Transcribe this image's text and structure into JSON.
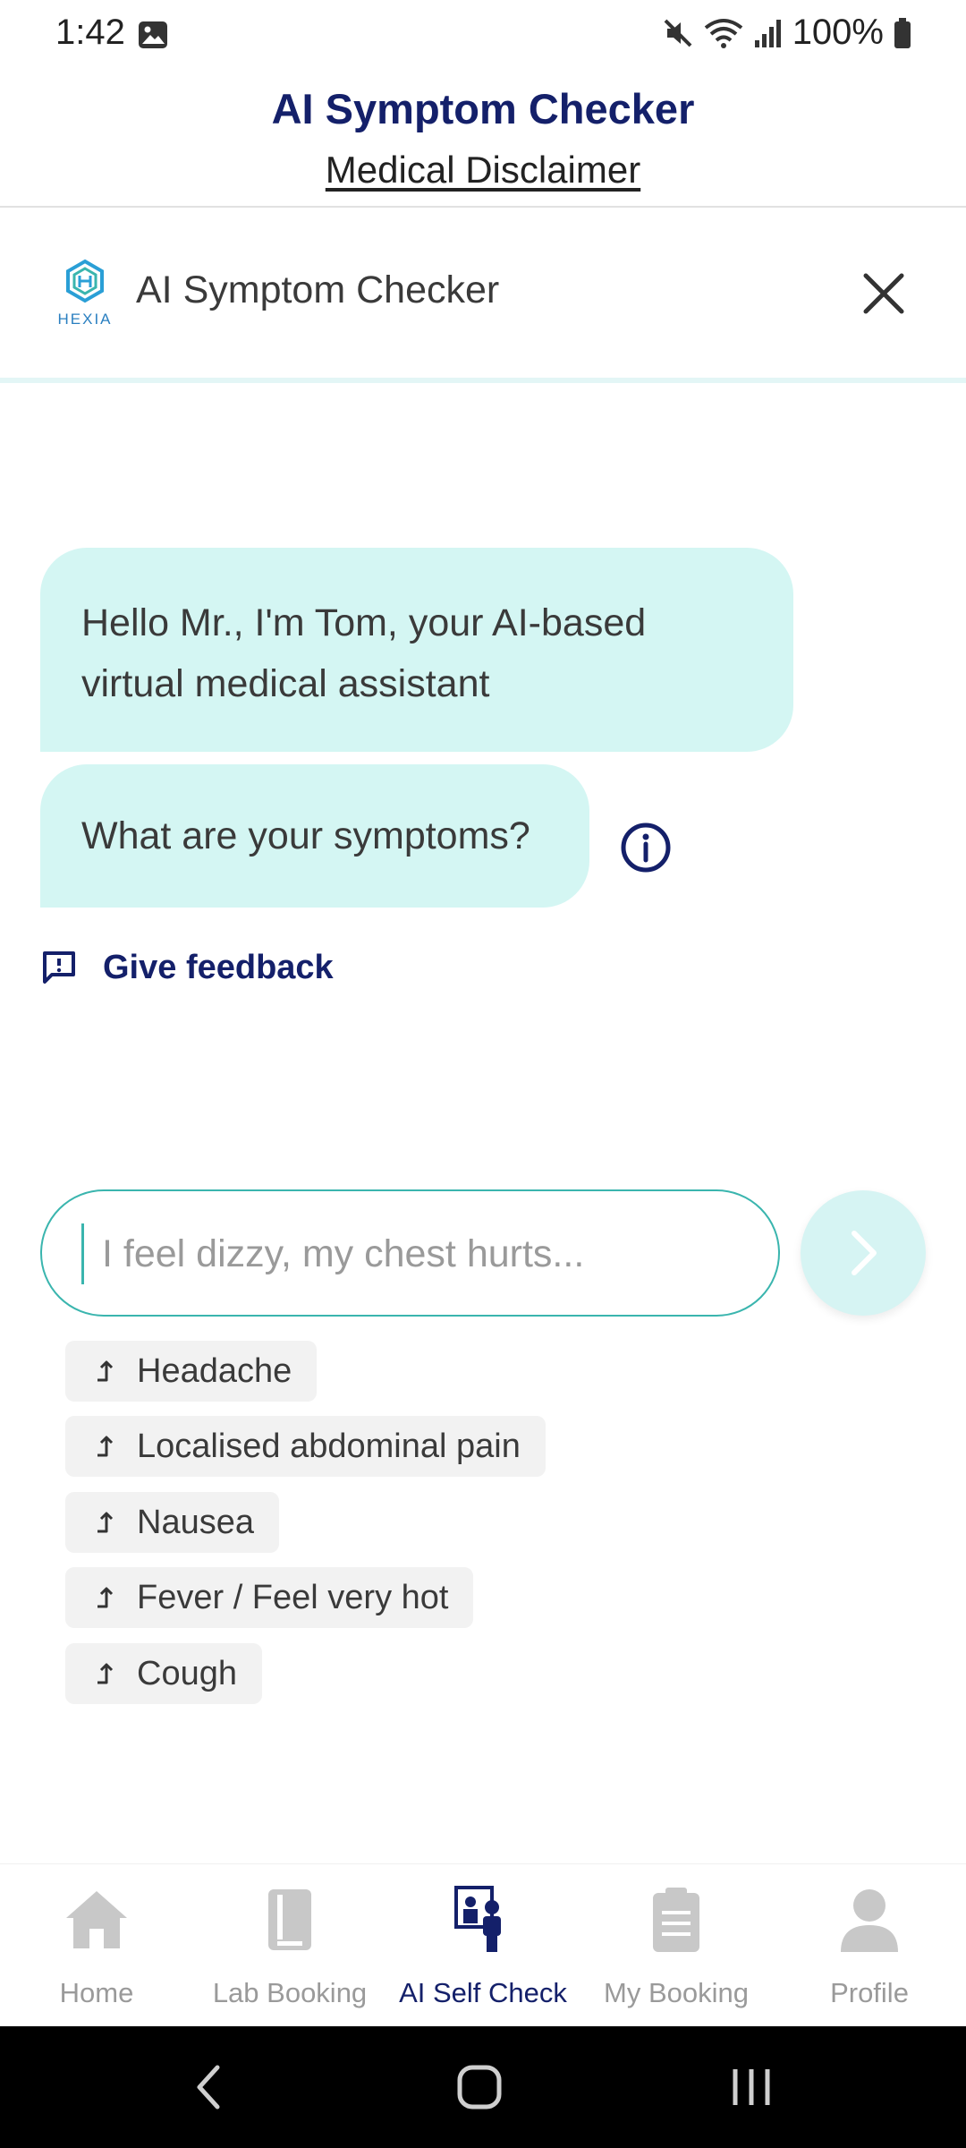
{
  "status_bar": {
    "time": "1:42",
    "battery": "100%"
  },
  "header": {
    "title": "AI Symptom Checker",
    "disclaimer_link": "Medical Disclaimer"
  },
  "chat_header": {
    "logo_text": "HEXIA",
    "title": "AI Symptom Checker"
  },
  "messages": [
    {
      "text": "Hello Mr., I'm Tom, your AI-based virtual medical assistant"
    },
    {
      "text": "What are your symptoms?"
    }
  ],
  "feedback": {
    "label": "Give feedback"
  },
  "input": {
    "placeholder": "I feel dizzy, my chest hurts..."
  },
  "suggestions": [
    {
      "label": "Headache"
    },
    {
      "label": "Localised abdominal pain"
    },
    {
      "label": "Nausea"
    },
    {
      "label": "Fever / Feel very hot"
    },
    {
      "label": "Cough"
    }
  ],
  "bottom_nav": {
    "items": [
      {
        "label": "Home",
        "icon": "home-icon"
      },
      {
        "label": "Lab Booking",
        "icon": "lab-booking-icon"
      },
      {
        "label": "AI Self Check",
        "icon": "ai-self-check-icon",
        "active": true
      },
      {
        "label": "My Booking",
        "icon": "clipboard-icon"
      },
      {
        "label": "Profile",
        "icon": "profile-icon"
      }
    ]
  },
  "colors": {
    "brand_navy": "#14206a",
    "bubble_bg": "#d4f6f3",
    "accent_teal": "#3ab5ae",
    "inactive_gray": "#9a9a9a"
  }
}
